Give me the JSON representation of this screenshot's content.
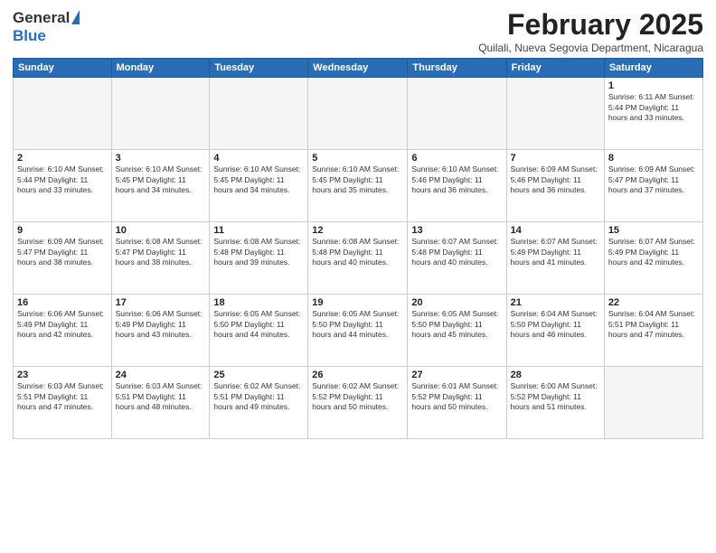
{
  "header": {
    "logo_general": "General",
    "logo_blue": "Blue",
    "month_title": "February 2025",
    "subtitle": "Quilali, Nueva Segovia Department, Nicaragua"
  },
  "weekdays": [
    "Sunday",
    "Monday",
    "Tuesday",
    "Wednesday",
    "Thursday",
    "Friday",
    "Saturday"
  ],
  "weeks": [
    [
      {
        "day": "",
        "info": ""
      },
      {
        "day": "",
        "info": ""
      },
      {
        "day": "",
        "info": ""
      },
      {
        "day": "",
        "info": ""
      },
      {
        "day": "",
        "info": ""
      },
      {
        "day": "",
        "info": ""
      },
      {
        "day": "1",
        "info": "Sunrise: 6:11 AM\nSunset: 5:44 PM\nDaylight: 11 hours\nand 33 minutes."
      }
    ],
    [
      {
        "day": "2",
        "info": "Sunrise: 6:10 AM\nSunset: 5:44 PM\nDaylight: 11 hours\nand 33 minutes."
      },
      {
        "day": "3",
        "info": "Sunrise: 6:10 AM\nSunset: 5:45 PM\nDaylight: 11 hours\nand 34 minutes."
      },
      {
        "day": "4",
        "info": "Sunrise: 6:10 AM\nSunset: 5:45 PM\nDaylight: 11 hours\nand 34 minutes."
      },
      {
        "day": "5",
        "info": "Sunrise: 6:10 AM\nSunset: 5:45 PM\nDaylight: 11 hours\nand 35 minutes."
      },
      {
        "day": "6",
        "info": "Sunrise: 6:10 AM\nSunset: 5:46 PM\nDaylight: 11 hours\nand 36 minutes."
      },
      {
        "day": "7",
        "info": "Sunrise: 6:09 AM\nSunset: 5:46 PM\nDaylight: 11 hours\nand 36 minutes."
      },
      {
        "day": "8",
        "info": "Sunrise: 6:09 AM\nSunset: 5:47 PM\nDaylight: 11 hours\nand 37 minutes."
      }
    ],
    [
      {
        "day": "9",
        "info": "Sunrise: 6:09 AM\nSunset: 5:47 PM\nDaylight: 11 hours\nand 38 minutes."
      },
      {
        "day": "10",
        "info": "Sunrise: 6:08 AM\nSunset: 5:47 PM\nDaylight: 11 hours\nand 38 minutes."
      },
      {
        "day": "11",
        "info": "Sunrise: 6:08 AM\nSunset: 5:48 PM\nDaylight: 11 hours\nand 39 minutes."
      },
      {
        "day": "12",
        "info": "Sunrise: 6:08 AM\nSunset: 5:48 PM\nDaylight: 11 hours\nand 40 minutes."
      },
      {
        "day": "13",
        "info": "Sunrise: 6:07 AM\nSunset: 5:48 PM\nDaylight: 11 hours\nand 40 minutes."
      },
      {
        "day": "14",
        "info": "Sunrise: 6:07 AM\nSunset: 5:49 PM\nDaylight: 11 hours\nand 41 minutes."
      },
      {
        "day": "15",
        "info": "Sunrise: 6:07 AM\nSunset: 5:49 PM\nDaylight: 11 hours\nand 42 minutes."
      }
    ],
    [
      {
        "day": "16",
        "info": "Sunrise: 6:06 AM\nSunset: 5:49 PM\nDaylight: 11 hours\nand 42 minutes."
      },
      {
        "day": "17",
        "info": "Sunrise: 6:06 AM\nSunset: 5:49 PM\nDaylight: 11 hours\nand 43 minutes."
      },
      {
        "day": "18",
        "info": "Sunrise: 6:05 AM\nSunset: 5:50 PM\nDaylight: 11 hours\nand 44 minutes."
      },
      {
        "day": "19",
        "info": "Sunrise: 6:05 AM\nSunset: 5:50 PM\nDaylight: 11 hours\nand 44 minutes."
      },
      {
        "day": "20",
        "info": "Sunrise: 6:05 AM\nSunset: 5:50 PM\nDaylight: 11 hours\nand 45 minutes."
      },
      {
        "day": "21",
        "info": "Sunrise: 6:04 AM\nSunset: 5:50 PM\nDaylight: 11 hours\nand 46 minutes."
      },
      {
        "day": "22",
        "info": "Sunrise: 6:04 AM\nSunset: 5:51 PM\nDaylight: 11 hours\nand 47 minutes."
      }
    ],
    [
      {
        "day": "23",
        "info": "Sunrise: 6:03 AM\nSunset: 5:51 PM\nDaylight: 11 hours\nand 47 minutes."
      },
      {
        "day": "24",
        "info": "Sunrise: 6:03 AM\nSunset: 5:51 PM\nDaylight: 11 hours\nand 48 minutes."
      },
      {
        "day": "25",
        "info": "Sunrise: 6:02 AM\nSunset: 5:51 PM\nDaylight: 11 hours\nand 49 minutes."
      },
      {
        "day": "26",
        "info": "Sunrise: 6:02 AM\nSunset: 5:52 PM\nDaylight: 11 hours\nand 50 minutes."
      },
      {
        "day": "27",
        "info": "Sunrise: 6:01 AM\nSunset: 5:52 PM\nDaylight: 11 hours\nand 50 minutes."
      },
      {
        "day": "28",
        "info": "Sunrise: 6:00 AM\nSunset: 5:52 PM\nDaylight: 11 hours\nand 51 minutes."
      },
      {
        "day": "",
        "info": ""
      }
    ]
  ]
}
